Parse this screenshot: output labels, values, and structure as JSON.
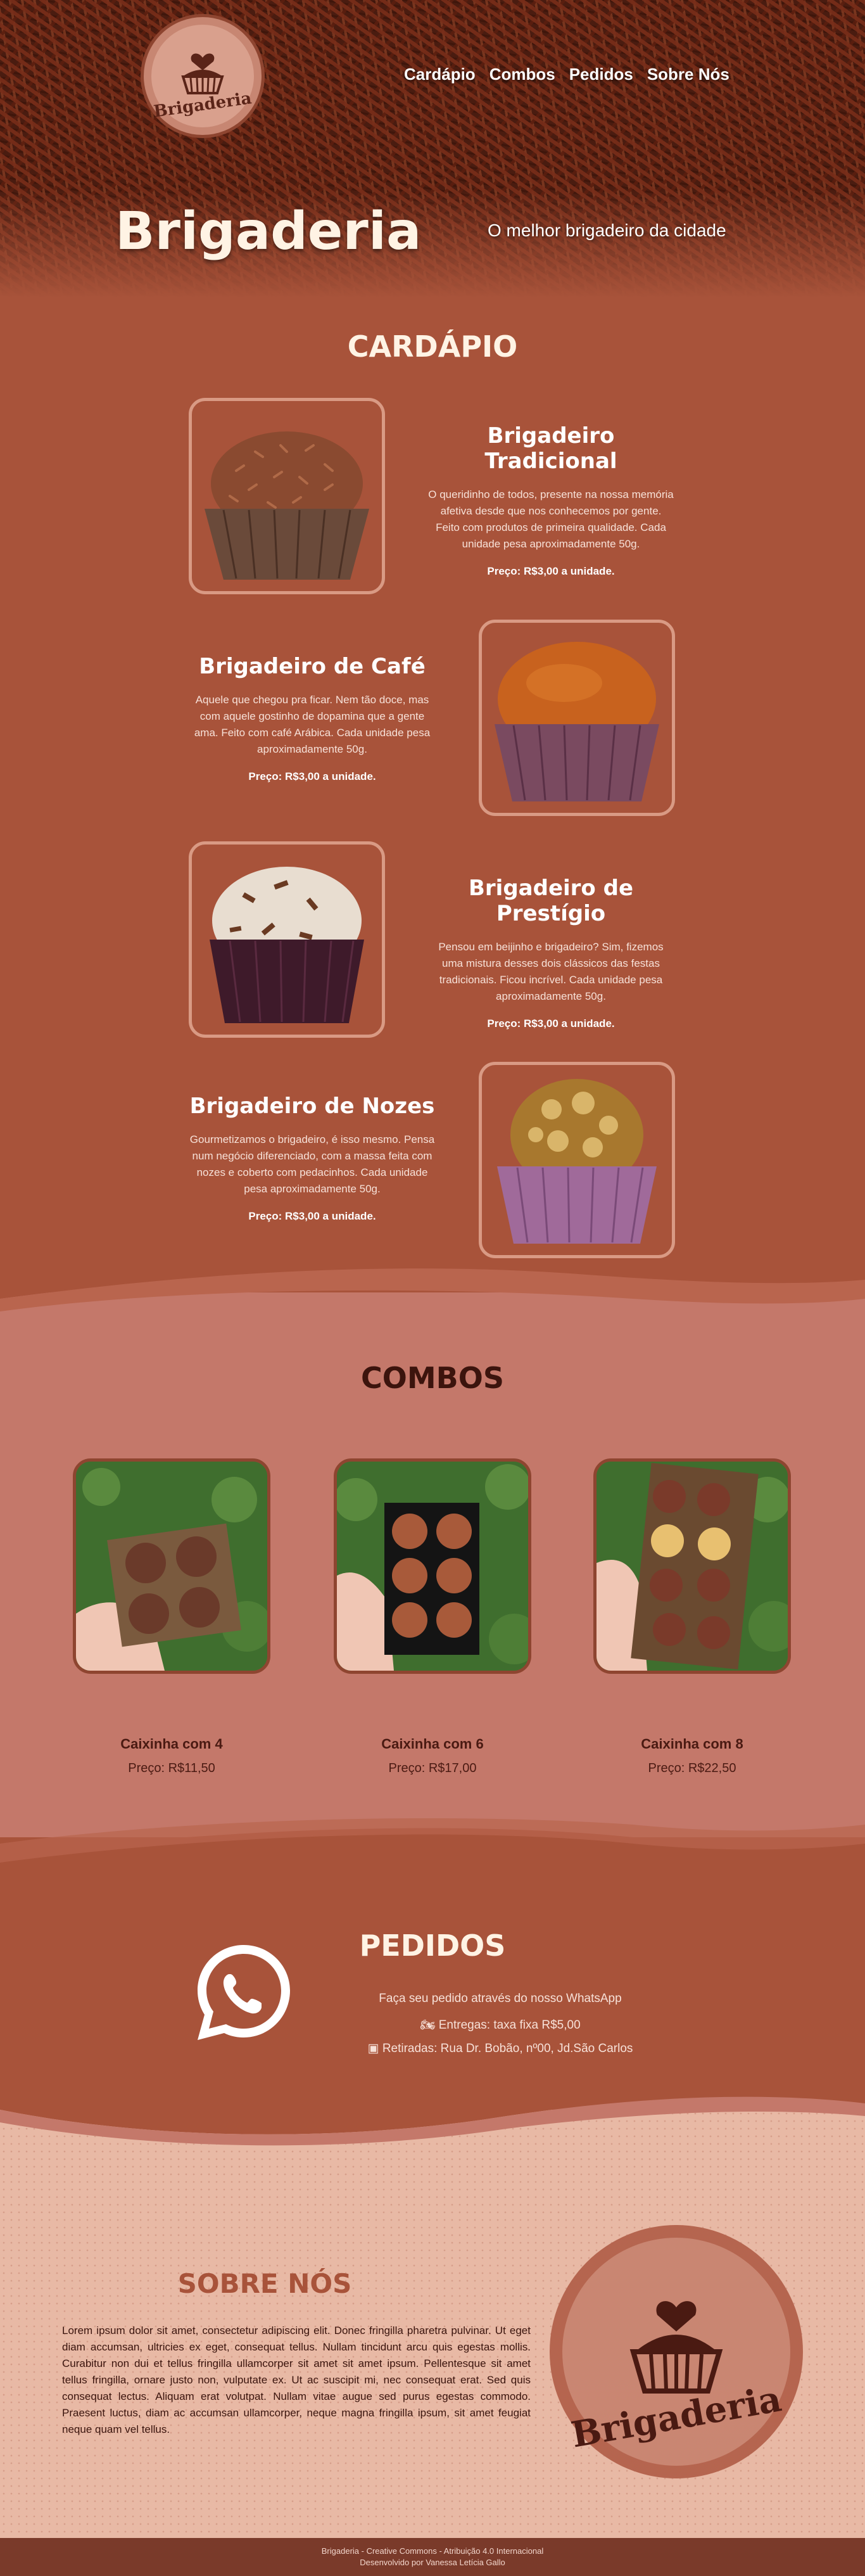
{
  "header": {
    "logo_text": "Brigaderia",
    "nav": [
      "Cardápio",
      "Combos",
      "Pedidos",
      "Sobre Nós"
    ],
    "brand": "Brigaderia",
    "tagline": "O melhor brigadeiro da cidade"
  },
  "cardapio": {
    "title": "CARDÁPIO",
    "items": [
      {
        "name": "Brigadeiro Tradicional",
        "description": "O queridinho de todos, presente na nossa memória afetiva desde que nos conhecemos por gente. Feito com produtos de primeira qualidade. Cada unidade pesa aproximadamente 50g.",
        "price": "Preço: R$3,00 a unidade."
      },
      {
        "name": "Brigadeiro de Café",
        "description": "Aquele que chegou pra ficar. Nem tão doce, mas com aquele gostinho de dopamina que a gente ama. Feito com café Arábica. Cada unidade pesa aproximadamente 50g.",
        "price": "Preço: R$3,00 a unidade."
      },
      {
        "name": "Brigadeiro de Prestígio",
        "description": "Pensou em beijinho e brigadeiro? Sim, fizemos uma mistura desses dois clássicos das festas tradicionais. Ficou incrível. Cada unidade pesa aproximadamente 50g.",
        "price": "Preço: R$3,00 a unidade."
      },
      {
        "name": "Brigadeiro de Nozes",
        "description": "Gourmetizamos o brigadeiro, é isso mesmo. Pensa num negócio diferenciado, com a massa feita com nozes e coberto com pedacinhos. Cada unidade pesa aproximadamente 50g.",
        "price": "Preço: R$3,00 a unidade."
      }
    ]
  },
  "combos": {
    "title": "COMBOS",
    "items": [
      {
        "name": "Caixinha com 4",
        "price": "Preço: R$11,50"
      },
      {
        "name": "Caixinha com 6",
        "price": "Preço: R$17,00"
      },
      {
        "name": "Caixinha com 8",
        "price": "Preço: R$22,50"
      }
    ]
  },
  "pedidos": {
    "title": "PEDIDOS",
    "line1": "Faça seu pedido através do nosso WhatsApp",
    "line2": "Entregas: taxa fixa R$5,00",
    "line3": "Retiradas: Rua Dr. Bobão, nº00, Jd.São Carlos"
  },
  "sobre": {
    "title": "SOBRE NÓS",
    "text": "Lorem ipsum dolor sit amet, consectetur adipiscing elit. Donec fringilla pharetra pulvinar. Ut eget diam accumsan, ultricies ex eget, consequat tellus. Nullam tincidunt arcu quis egestas mollis. Curabitur non dui et tellus fringilla ullamcorper sit amet sit amet ipsum. Pellentesque sit amet tellus fringilla, ornare justo non, vulputate ex. Ut ac suscipit mi, nec consequat erat. Sed quis consequat lectus. Aliquam erat volutpat. Nullam vitae augue sed purus egestas commodo. Praesent luctus, diam ac accumsan ullamcorper, neque magna fringilla ipsum, sit amet feugiat neque quam vel tellus.",
    "logo_text": "Brigaderia"
  },
  "footer": {
    "line1": "Brigaderia - Creative Commons - Atribuição 4.0 Internacional",
    "line2": "Desenvolvido por Vanessa Letícia Gallo"
  },
  "colors": {
    "primary": "#a8533a",
    "combos_bg": "#c4786a",
    "sobre_bg": "#e8b9a5",
    "dark_text": "#4a1a12"
  }
}
